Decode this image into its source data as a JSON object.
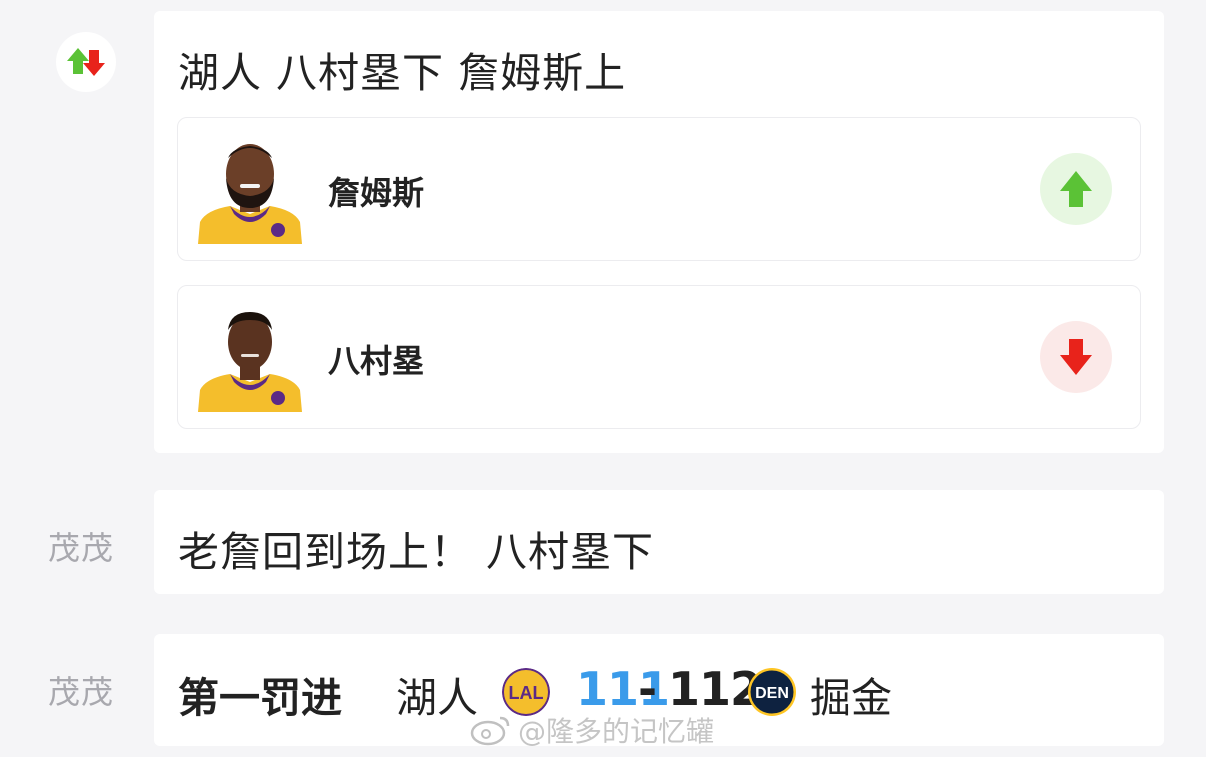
{
  "substitution": {
    "icon": "substitution-arrows-icon",
    "title": "湖人 八村塁下 詹姆斯上",
    "player_in": {
      "name": "詹姆斯",
      "direction": "in",
      "icon": "arrow-up-icon",
      "color": "#5bc236"
    },
    "player_out": {
      "name": "八村塁",
      "direction": "out",
      "icon": "arrow-down-icon",
      "color": "#e8231b"
    }
  },
  "messages": [
    {
      "author": "茂茂",
      "text": "老詹回到场上！ 八村塁下"
    },
    {
      "author": "茂茂",
      "event": "第一罚进",
      "home_team": "湖人",
      "home_logo": "LAL",
      "home_score": "111",
      "separator": "-",
      "away_score": "112",
      "away_logo": "DEN",
      "away_team": "掘金",
      "home_score_color": "#3a9bea"
    }
  ],
  "watermark": "@隆多的记忆罐"
}
